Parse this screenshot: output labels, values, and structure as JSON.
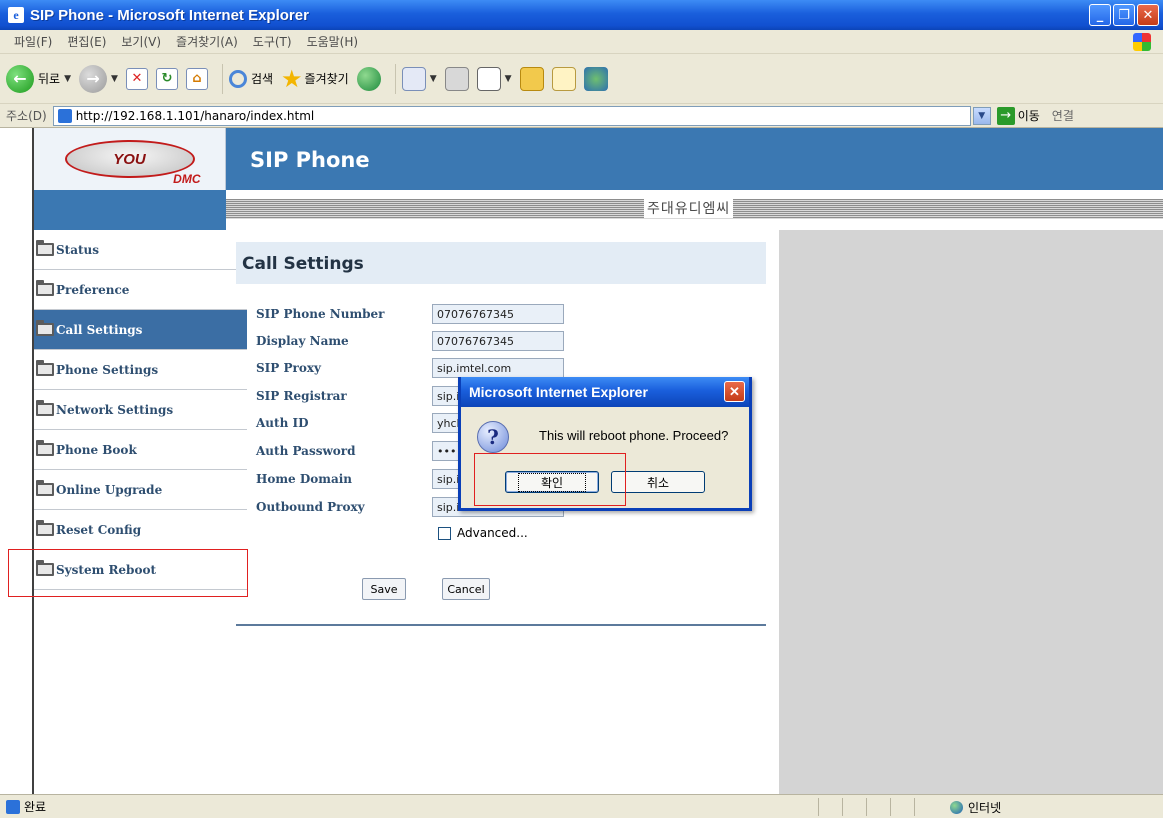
{
  "window": {
    "title": "SIP Phone - Microsoft Internet Explorer"
  },
  "menu": [
    "파일(F)",
    "편집(E)",
    "보기(V)",
    "즐겨찾기(A)",
    "도구(T)",
    "도움말(H)"
  ],
  "toolbar": {
    "back_label": "뒤로",
    "search_label": "검색",
    "favorites_label": "즐겨찾기"
  },
  "address": {
    "label": "주소(D)",
    "url": "http://192.168.1.101/hanaro/index.html",
    "go_label": "이동",
    "links_label": "연결"
  },
  "page": {
    "logo": {
      "main": "YOU",
      "sub": "DMC"
    },
    "header_title": "SIP Phone",
    "company": "주대유디엠씨",
    "nav": [
      {
        "label": "Status",
        "active": false
      },
      {
        "label": "Preference",
        "active": false
      },
      {
        "label": "Call Settings",
        "active": true
      },
      {
        "label": "Phone Settings",
        "active": false
      },
      {
        "label": "Network Settings",
        "active": false
      },
      {
        "label": "Phone Book",
        "active": false
      },
      {
        "label": "Online Upgrade",
        "active": false
      },
      {
        "label": "Reset Config",
        "active": false
      },
      {
        "label": "System Reboot",
        "active": false
      }
    ],
    "section_title": "Call Settings",
    "fields": [
      {
        "label": "SIP Phone Number",
        "value": "07076767345"
      },
      {
        "label": "Display Name",
        "value": "07076767345"
      },
      {
        "label": "SIP Proxy",
        "value": "sip.imtel.com"
      },
      {
        "label": "SIP Registrar",
        "value": "sip.i"
      },
      {
        "label": "Auth ID",
        "value": "yhcl"
      },
      {
        "label": "Auth Password",
        "value": "•••"
      },
      {
        "label": "Home Domain",
        "value": "sip.i"
      },
      {
        "label": "Outbound Proxy",
        "value": "sip.imtel.com"
      }
    ],
    "advanced_label": "Advanced...",
    "save_label": "Save",
    "cancel_label": "Cancel"
  },
  "dialog": {
    "title": "Microsoft Internet Explorer",
    "message": "This will reboot phone. Proceed?",
    "ok_label": "확인",
    "cancel_label": "취소"
  },
  "status": {
    "text": "완료",
    "zone": "인터넷"
  },
  "colors": {
    "accent": "#3b78b2",
    "nav_active": "#3b6ea4",
    "annotation": "#e02020",
    "xp_titlebar": "#1a5fdc"
  }
}
